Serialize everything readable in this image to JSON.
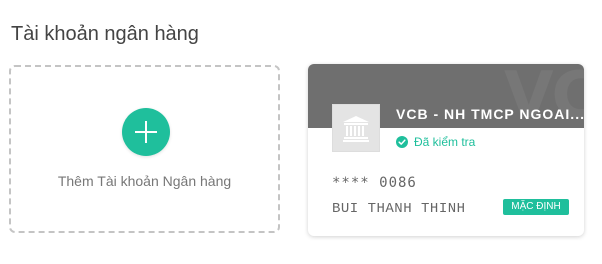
{
  "page": {
    "title": "Tài khoản ngân hàng"
  },
  "add_card": {
    "label": "Thêm Tài khoản Ngân hàng",
    "icon": "plus-icon"
  },
  "bank_card": {
    "watermark": "VC",
    "bank_logo_icon": "bank-building-icon",
    "bank_name": "VCB - NH TMCP NGOAI...",
    "verified_icon": "check-circle-icon",
    "verified_label": "Đã kiểm tra",
    "card_number": "**** 0086",
    "holder_name": "BUI THANH THINH",
    "default_badge": "MẶC ĐỊNH"
  },
  "colors": {
    "accent": "#1fbf9c",
    "header_bg": "#6f6f6f",
    "dashed_border": "#c4c4c4"
  }
}
